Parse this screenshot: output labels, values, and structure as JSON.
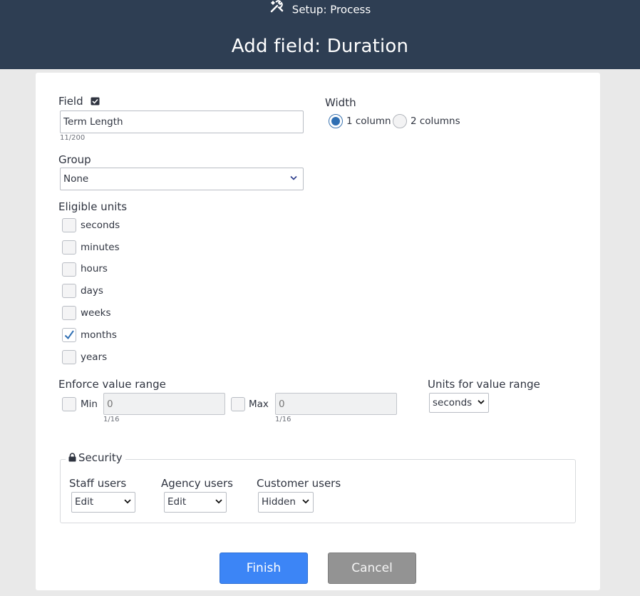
{
  "header": {
    "breadcrumb": "Setup: Process",
    "title": "Add field: Duration"
  },
  "field": {
    "label": "Field",
    "value": "Term Length",
    "counter": "11/200"
  },
  "width": {
    "label": "Width",
    "options": [
      {
        "label": "1 column",
        "selected": true
      },
      {
        "label": "2 columns",
        "selected": false
      }
    ]
  },
  "group": {
    "label": "Group",
    "value": "None"
  },
  "eligible_units": {
    "label": "Eligible units",
    "items": [
      {
        "label": "seconds",
        "checked": false
      },
      {
        "label": "minutes",
        "checked": false
      },
      {
        "label": "hours",
        "checked": false
      },
      {
        "label": "days",
        "checked": false
      },
      {
        "label": "weeks",
        "checked": false
      },
      {
        "label": "months",
        "checked": true
      },
      {
        "label": "years",
        "checked": false
      }
    ]
  },
  "range": {
    "label": "Enforce value range",
    "min_label": "Min",
    "min_value": "0",
    "min_counter": "1/16",
    "max_label": "Max",
    "max_value": "0",
    "max_counter": "1/16",
    "units_label": "Units for value range",
    "units_value": "seconds"
  },
  "security": {
    "legend": "Security",
    "staff": {
      "label": "Staff users",
      "value": "Edit"
    },
    "agency": {
      "label": "Agency users",
      "value": "Edit"
    },
    "customer": {
      "label": "Customer users",
      "value": "Hidden"
    }
  },
  "buttons": {
    "finish": "Finish",
    "cancel": "Cancel"
  },
  "colors": {
    "header_bg": "#2e3e53",
    "finish_bg": "#3c85f6",
    "cancel_bg": "#939393",
    "radio_on": "#2f6fb3"
  }
}
